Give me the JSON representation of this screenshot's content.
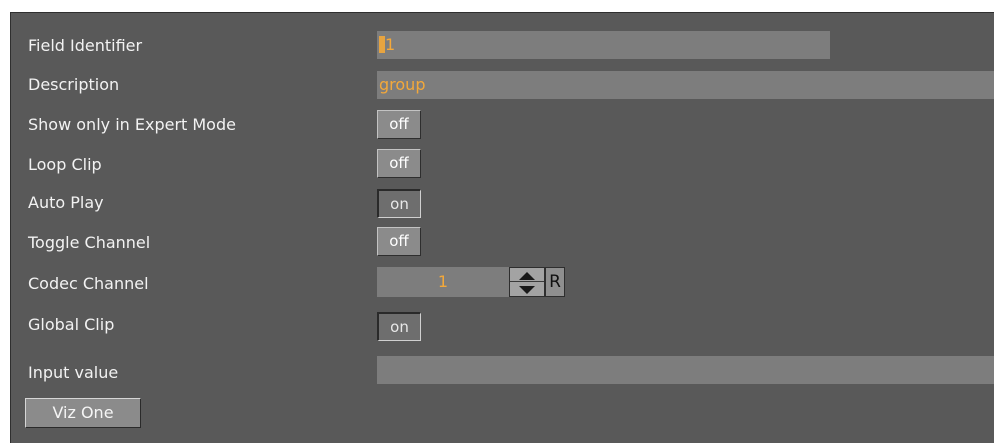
{
  "fields": {
    "field_identifier": {
      "label": "Field Identifier",
      "value": "1"
    },
    "description": {
      "label": "Description",
      "value": "group"
    },
    "show_only_expert": {
      "label": "Show only in Expert Mode",
      "value": "off"
    },
    "loop_clip": {
      "label": "Loop Clip",
      "value": "off"
    },
    "auto_play": {
      "label": "Auto Play",
      "value": "on"
    },
    "toggle_channel": {
      "label": "Toggle Channel",
      "value": "off"
    },
    "codec_channel": {
      "label": "Codec Channel",
      "value": "1",
      "reset_label": "R"
    },
    "global_clip": {
      "label": "Global Clip",
      "value": "on"
    },
    "input_value": {
      "label": "Input value",
      "value": ""
    }
  },
  "buttons": {
    "viz_one": "Viz One"
  },
  "colors": {
    "panel_bg": "#595959",
    "field_bg": "#7d7d7d",
    "accent_text": "#f3a83a",
    "label_text": "#f2f2f2"
  }
}
